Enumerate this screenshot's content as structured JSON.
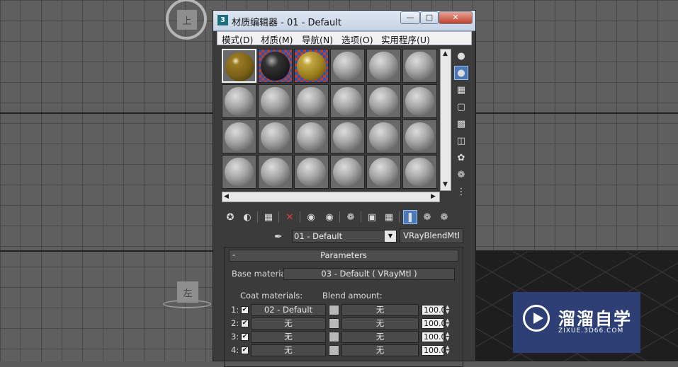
{
  "window": {
    "title": "材质编辑器 - 01 - Default",
    "icon_text": "3",
    "controls": [
      "minimize-icon",
      "maximize-icon",
      "close-icon"
    ]
  },
  "menu": {
    "items": [
      "模式(D)",
      "材质(M)",
      "导航(N)",
      "选项(O)",
      "实用程序(U)"
    ]
  },
  "slots": {
    "rows": 4,
    "cols": 6,
    "special": [
      {
        "index": 0,
        "style": "yellow",
        "selected": true
      },
      {
        "index": 1,
        "style": "dark-checker",
        "selected": false
      },
      {
        "index": 2,
        "style": "gold-checker",
        "selected": false
      }
    ]
  },
  "material": {
    "name": "01 - Default",
    "type": "VRayBlendMtl"
  },
  "parameters": {
    "rollout_title": "Parameters",
    "collapse_symbol": "-",
    "base_material_label": "Base material:",
    "base_material_value": "03 - Default  ( VRayMtl )",
    "coat_materials_label": "Coat materials:",
    "blend_amount_label": "Blend amount:",
    "coats": [
      {
        "index": "1:",
        "checked": true,
        "material": "02 - Default",
        "blend": "无",
        "amount": "100.0"
      },
      {
        "index": "2:",
        "checked": true,
        "material": "无",
        "blend": "无",
        "amount": "100.0"
      },
      {
        "index": "3:",
        "checked": true,
        "material": "无",
        "blend": "无",
        "amount": "100.0"
      },
      {
        "index": "4:",
        "checked": true,
        "material": "无",
        "blend": "无",
        "amount": "100.0"
      }
    ]
  },
  "viewport": {
    "cube_top_label": "上",
    "cube_left_label": "左"
  },
  "watermark": {
    "title": "溜溜自学",
    "subtitle": "ZIXUE.3D66.COM"
  }
}
